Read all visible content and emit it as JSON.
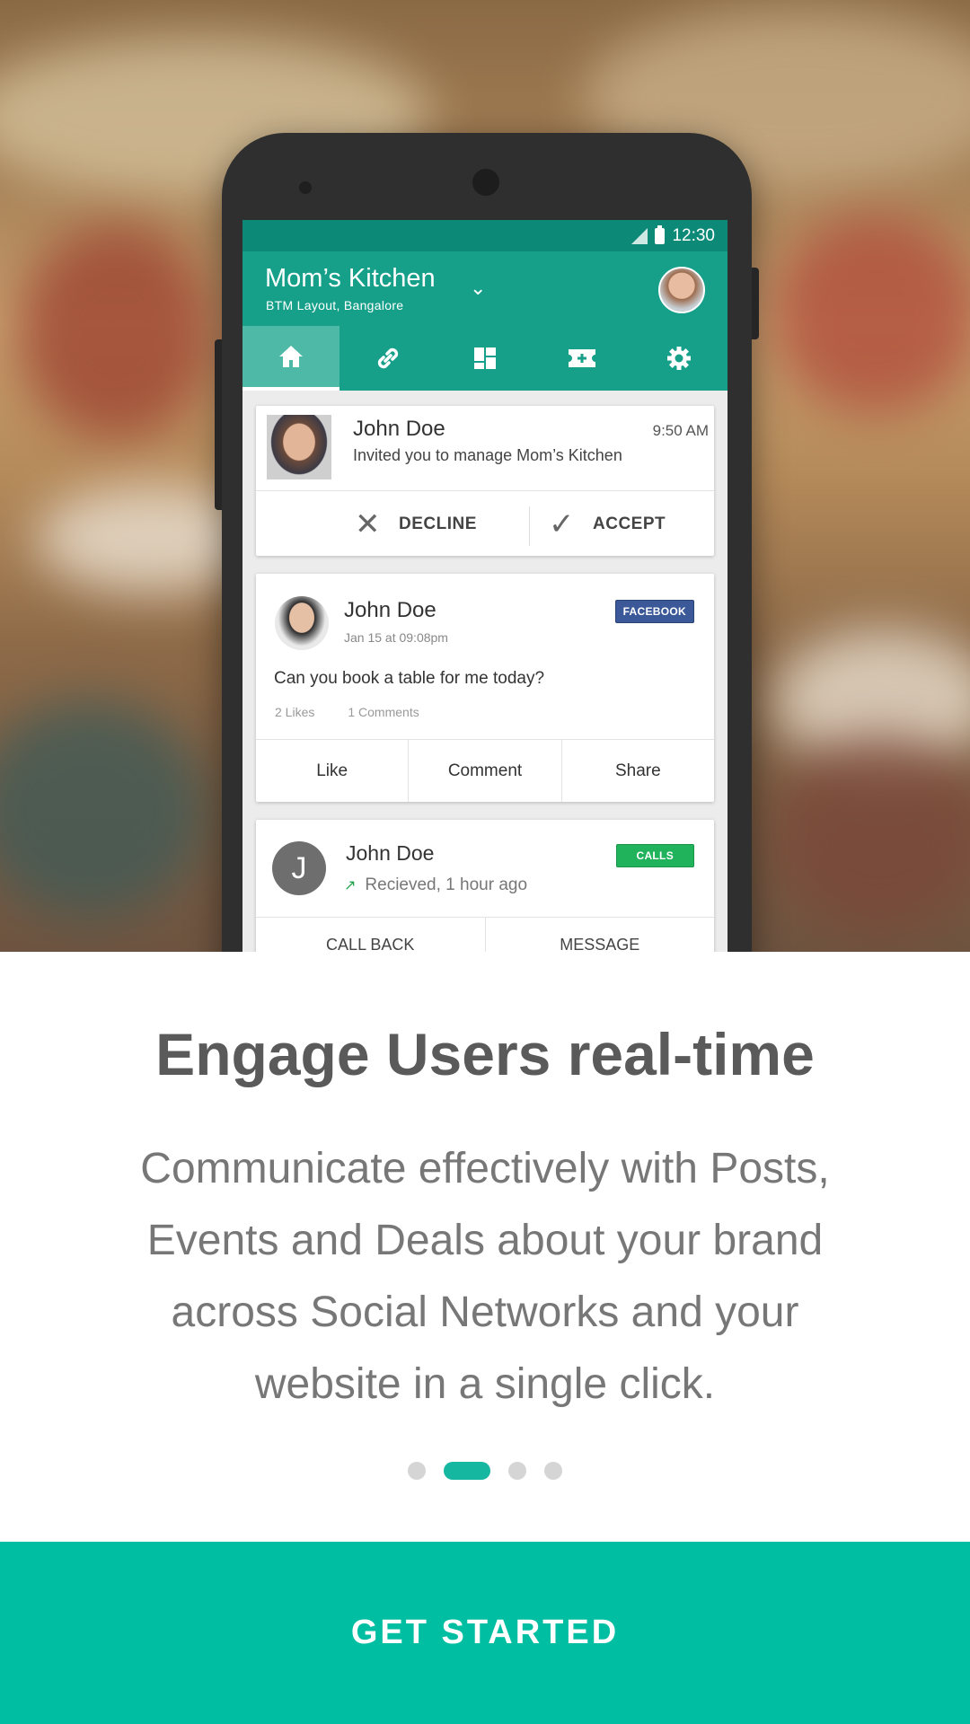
{
  "status": {
    "time": "12:30"
  },
  "app": {
    "title": "Mom’s Kitchen",
    "subtitle": "BTM Layout, Bangalore",
    "tabs": [
      {
        "icon": "home-icon"
      },
      {
        "icon": "link-icon"
      },
      {
        "icon": "dashboard-icon"
      },
      {
        "icon": "ticket-icon"
      },
      {
        "icon": "gear-icon"
      }
    ]
  },
  "invite_card": {
    "name": "John Doe",
    "time": "9:50 AM",
    "message": "Invited you to manage Mom’s Kitchen",
    "decline_label": "DECLINE",
    "accept_label": "ACCEPT"
  },
  "post_card": {
    "name": "John Doe",
    "date": "Jan 15 at 09:08pm",
    "badge": "FACEBOOK",
    "post": "Can you book a table for me today?",
    "likes": "2 Likes",
    "comments": "1 Comments",
    "actions": [
      "Like",
      "Comment",
      "Share"
    ]
  },
  "call_card": {
    "initial": "J",
    "name": "John Doe",
    "status": "Recieved, 1 hour ago",
    "badge": "CALLS",
    "actions": [
      "CALL BACK",
      "MESSAGE"
    ]
  },
  "onboarding": {
    "headline": "Engage Users real-time",
    "body": "Communicate effectively with Posts, Events and Deals about your brand across Social Networks and your website in a single click.",
    "page_index": 2,
    "page_count": 4,
    "cta_label": "GET STARTED"
  },
  "colors": {
    "primary": "#16a08a",
    "cta": "#00bea2",
    "facebook": "#3b5998",
    "calls": "#21b35b"
  }
}
